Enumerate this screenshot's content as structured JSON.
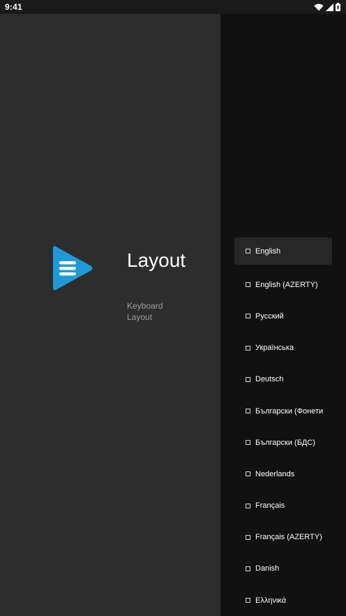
{
  "status_bar": {
    "time": "9:41",
    "icons": [
      "wifi-icon",
      "signal-icon",
      "battery-icon"
    ]
  },
  "app": {
    "title": "Layout",
    "subtitle": "Keyboard Layout",
    "logo_color": "#1f9ad8"
  },
  "layout_list": {
    "selected_index": 0,
    "items": [
      {
        "label": "English"
      },
      {
        "label": "English (AZERTY)"
      },
      {
        "label": "Русский"
      },
      {
        "label": "Українська"
      },
      {
        "label": "Deutsch"
      },
      {
        "label": "Български (Фонетична)"
      },
      {
        "label": "Български (БДС)"
      },
      {
        "label": "Nederlands"
      },
      {
        "label": "Français"
      },
      {
        "label": "Français (AZERTY)"
      },
      {
        "label": "Danish"
      },
      {
        "label": "Ελληνικά"
      }
    ]
  },
  "colors": {
    "left_background": "#2d2d2d",
    "right_background": "#111111",
    "selected_background": "#272727",
    "accent": "#1f9ad8"
  }
}
